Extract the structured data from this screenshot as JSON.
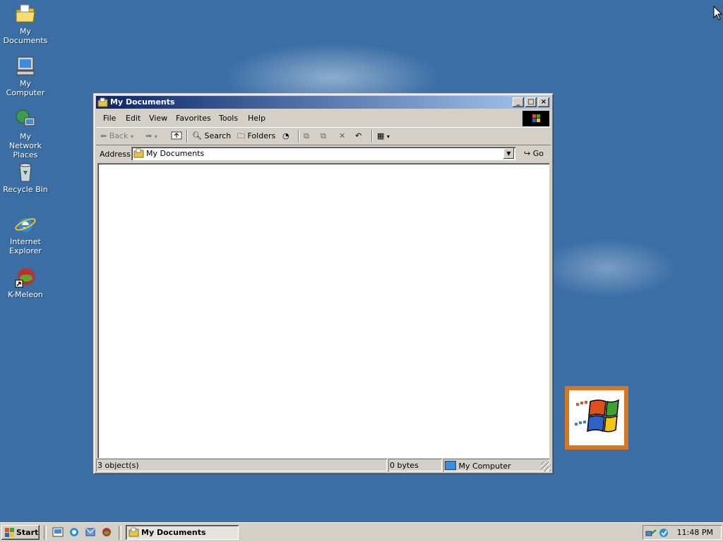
{
  "desktop": {
    "icons": [
      {
        "label": "My Documents",
        "icon": "my-documents-folder-icon"
      },
      {
        "label": "My Computer",
        "icon": "my-computer-icon"
      },
      {
        "label": "My Network Places",
        "icon": "network-places-icon"
      },
      {
        "label": "Recycle Bin",
        "icon": "recycle-bin-icon"
      },
      {
        "label": "Internet Explorer",
        "icon": "internet-explorer-icon"
      },
      {
        "label": "K-Meleon",
        "icon": "k-meleon-icon"
      }
    ],
    "background_color": "#3a6ea5"
  },
  "window": {
    "title": "My Documents",
    "menu": [
      "File",
      "Edit",
      "View",
      "Favorites",
      "Tools",
      "Help"
    ],
    "toolbar": {
      "back": "Back",
      "search": "Search",
      "folders": "Folders"
    },
    "address": {
      "label": "Address",
      "value": "My Documents",
      "go": "Go"
    },
    "status": {
      "objects": "3 object(s)",
      "size": "0 bytes",
      "zone": "My Computer"
    },
    "titlebar_colors": [
      "#0a246a",
      "#a6caf0"
    ]
  },
  "taskbar": {
    "start": "Start",
    "tasks": [
      "My Documents"
    ],
    "clock": "11:48 PM"
  }
}
